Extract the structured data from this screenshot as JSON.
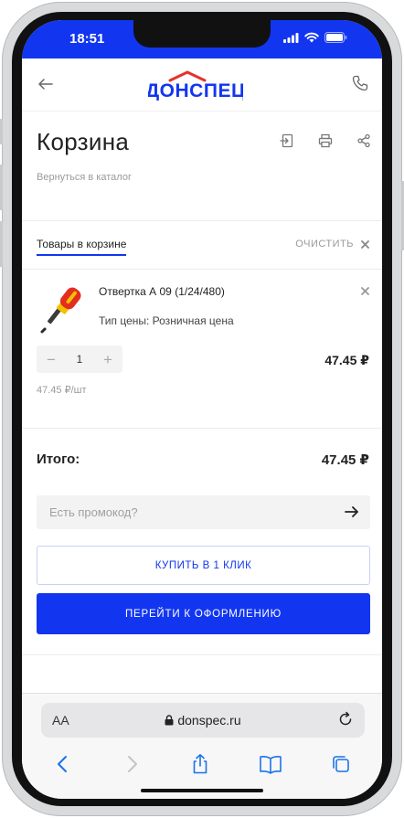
{
  "status_bar": {
    "time": "18:51"
  },
  "header": {
    "logo_text": "ДОНСПЕЦ"
  },
  "page": {
    "title": "Корзина",
    "back_link": "Вернуться в каталог"
  },
  "cart": {
    "tab_label": "Товары в корзине",
    "clear_label": "ОЧИСТИТЬ",
    "items": [
      {
        "name": "Отвертка А 09 (1/24/480)",
        "price_type": "Тип цены: Розничная цена",
        "quantity": "1",
        "minus": "−",
        "plus": "+",
        "total": "47.45 ₽",
        "unit_price": "47.45 ₽/шт"
      }
    ]
  },
  "summary": {
    "total_label": "Итого:",
    "total_value": "47.45 ₽",
    "promo_placeholder": "Есть промокод?",
    "one_click_label": "КУПИТЬ В 1 КЛИК",
    "checkout_label": "ПЕРЕЙТИ К ОФОРМЛЕНИЮ"
  },
  "browser": {
    "aa_label": "AA",
    "url": "donspec.ru"
  },
  "colors": {
    "brand_blue": "#1236f0",
    "accent_red": "#e5322d"
  },
  "icons": [
    "back-arrow-icon",
    "phone-icon",
    "export-icon",
    "print-icon",
    "share-icon",
    "close-icon",
    "arrow-right-icon",
    "lock-icon",
    "reload-icon",
    "chevron-left-icon",
    "chevron-right-icon",
    "share-upload-icon",
    "bookmarks-icon",
    "tabs-icon"
  ]
}
